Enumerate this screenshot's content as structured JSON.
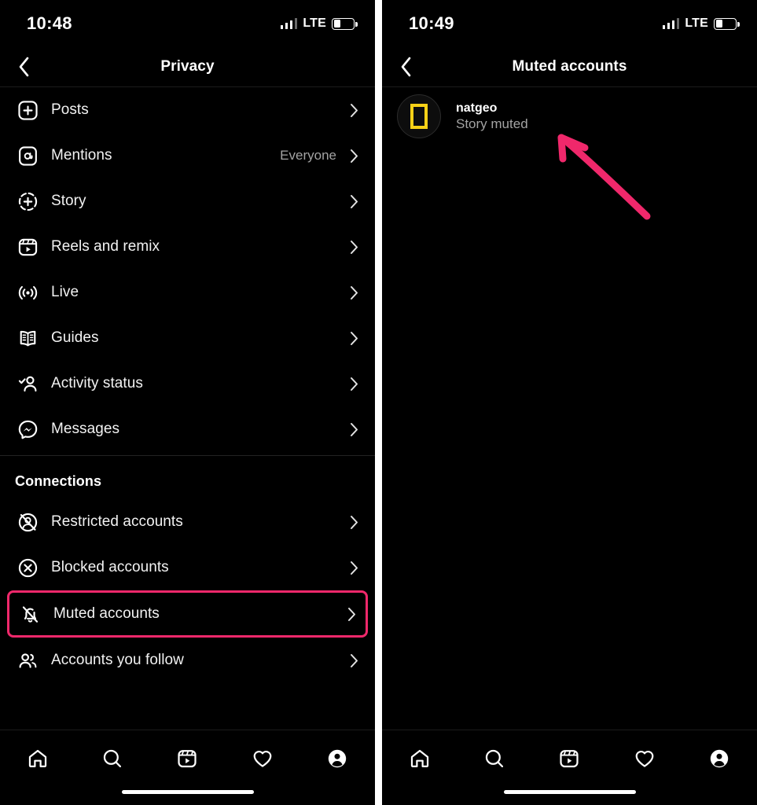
{
  "colors": {
    "accent_pink": "#f0286b",
    "background": "#000000",
    "text_primary": "#f2f2f2",
    "text_secondary": "#a3a3a3",
    "natgeo_yellow": "#f7d117"
  },
  "left_screen": {
    "status_bar": {
      "time": "10:48",
      "network_label": "LTE",
      "battery_percent": 35,
      "signal_icon": "signal-bars-icon",
      "battery_icon": "battery-icon"
    },
    "header": {
      "back_icon": "chevron-left-icon",
      "title": "Privacy"
    },
    "items": [
      {
        "label": "Posts",
        "value": "",
        "icon": "plus-square-icon"
      },
      {
        "label": "Mentions",
        "value": "Everyone",
        "icon": "at-sign-icon"
      },
      {
        "label": "Story",
        "value": "",
        "icon": "story-plus-icon"
      },
      {
        "label": "Reels and remix",
        "value": "",
        "icon": "reels-icon"
      },
      {
        "label": "Live",
        "value": "",
        "icon": "live-broadcast-icon"
      },
      {
        "label": "Guides",
        "value": "",
        "icon": "guides-book-icon"
      },
      {
        "label": "Activity status",
        "value": "",
        "icon": "activity-status-icon"
      },
      {
        "label": "Messages",
        "value": "",
        "icon": "messenger-icon"
      }
    ],
    "section": {
      "title": "Connections",
      "items": [
        {
          "label": "Restricted accounts",
          "value": "",
          "icon": "restricted-account-icon",
          "highlighted": false
        },
        {
          "label": "Blocked accounts",
          "value": "",
          "icon": "blocked-circle-x-icon",
          "highlighted": false
        },
        {
          "label": "Muted accounts",
          "value": "",
          "icon": "muted-bell-icon",
          "highlighted": true
        },
        {
          "label": "Accounts you follow",
          "value": "",
          "icon": "people-icon",
          "highlighted": false
        }
      ]
    },
    "tabbar": [
      {
        "name": "home",
        "icon": "home-icon"
      },
      {
        "name": "search",
        "icon": "search-icon"
      },
      {
        "name": "reels",
        "icon": "reels-icon"
      },
      {
        "name": "activity",
        "icon": "heart-icon"
      },
      {
        "name": "profile",
        "icon": "profile-avatar-icon"
      }
    ]
  },
  "right_screen": {
    "status_bar": {
      "time": "10:49",
      "network_label": "LTE",
      "battery_percent": 35,
      "signal_icon": "signal-bars-icon",
      "battery_icon": "battery-icon"
    },
    "header": {
      "back_icon": "chevron-left-icon",
      "title": "Muted accounts"
    },
    "account": {
      "username": "natgeo",
      "status": "Story muted",
      "avatar_icon": "natgeo-logo-icon"
    },
    "annotation": {
      "type": "arrow",
      "color": "#f0286b",
      "points_to": "Story muted"
    },
    "tabbar": [
      {
        "name": "home",
        "icon": "home-icon"
      },
      {
        "name": "search",
        "icon": "search-icon"
      },
      {
        "name": "reels",
        "icon": "reels-icon"
      },
      {
        "name": "activity",
        "icon": "heart-icon"
      },
      {
        "name": "profile",
        "icon": "profile-avatar-icon"
      }
    ]
  }
}
